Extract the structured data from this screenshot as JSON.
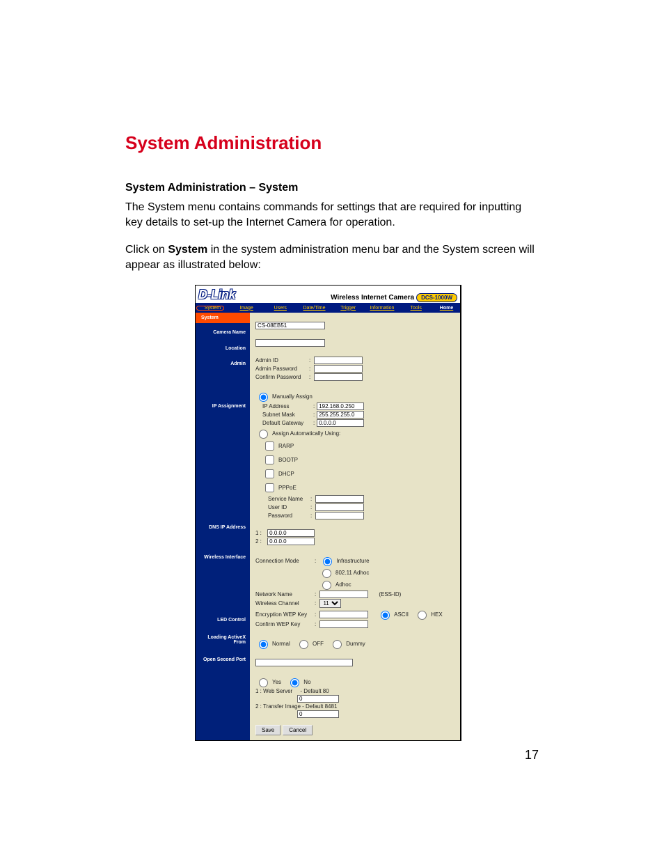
{
  "doc": {
    "title": "System Administration",
    "subtitle": "System Administration – System",
    "p1": "The System menu contains commands for settings that are required for inputting key details to set-up the Internet Camera for operation.",
    "p2a": "Click on ",
    "p2b": "System",
    "p2c": " in the system administration menu bar and the System screen will appear as illustrated below:",
    "pagenum": "17"
  },
  "ui": {
    "brand": "D-Link",
    "header_text": "Wireless Internet Camera",
    "model": "DCS-1000W",
    "menu": [
      "System",
      "Image",
      "Users",
      "Date/Time",
      "Trigger",
      "Information",
      "Tools",
      "Home"
    ],
    "sidebar": [
      "System",
      "Camera Name",
      "Location",
      "Admin",
      "IP Assignment",
      "DNS IP Address",
      "Wireless Interface",
      "LED Control",
      "Loading ActiveX From",
      "Open Second Port"
    ],
    "camera_name": "CS-08EB51",
    "location": "",
    "admin": {
      "id_label": "Admin ID",
      "pwd_label": "Admin Password",
      "cpwd_label": "Confirm Password",
      "id": "",
      "pwd": "",
      "cpwd": ""
    },
    "ip": {
      "manual_label": "Manually Assign",
      "ip_label": "IP Address",
      "mask_label": "Subnet Mask",
      "gw_label": "Default Gateway",
      "ip": "192.168.0.250",
      "mask": "255.255.255.0",
      "gw": "0.0.0.0",
      "auto_label": "Assign Automatically Using:",
      "rarp": "RARP",
      "bootp": "BOOTP",
      "dhcp": "DHCP",
      "pppoe": "PPPoE",
      "svc_label": "Service Name",
      "user_label": "User ID",
      "pw_label": "Password",
      "svc": "",
      "user": "",
      "pw": ""
    },
    "dns": {
      "one_label": "1 :",
      "two_label": "2 :",
      "one": "0.0.0.0",
      "two": "0.0.0.0"
    },
    "wifi": {
      "cm_label": "Connection Mode",
      "infra": "Infrastructure",
      "adhoc11": "802.11 Adhoc",
      "adhoc": "Adhoc",
      "nn_label": "Network Name",
      "ess": "(ESS-ID)",
      "nn": "",
      "ch_label": "Wireless Channel",
      "ch": "11",
      "wep_label": "Encryption WEP Key",
      "wep": "",
      "ascii": "ASCII",
      "hex": "HEX",
      "cwep_label": "Confirm WEP Key",
      "cwep": ""
    },
    "led": {
      "normal": "Normal",
      "off": "OFF",
      "dummy": "Dummy"
    },
    "activex": "",
    "port": {
      "yes": "Yes",
      "no": "No",
      "web_label": "1 : Web Server     - Default 80",
      "web": "0",
      "xfer_label": "2 : Transfer Image - Default 8481",
      "xfer": "0"
    },
    "save": "Save",
    "cancel": "Cancel"
  }
}
